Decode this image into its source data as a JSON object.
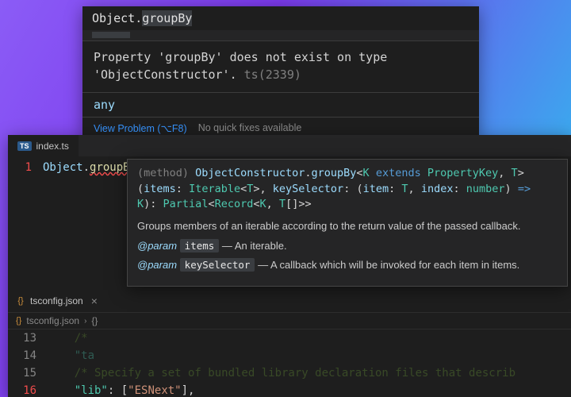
{
  "error_tooltip": {
    "code_line_prefix": "Object",
    "code_line_dot": ".",
    "code_line_method": "groupBy",
    "message_l1": "Property 'groupBy' does not exist on type",
    "message_l2": "'ObjectConstructor'.",
    "error_code": "ts(2339)",
    "type_text": "any",
    "view_problem_label": "View Problem (⌥F8)",
    "no_fix_label": "No quick fixes available"
  },
  "editor_top": {
    "tab_badge": "TS",
    "tab_label": "index.ts",
    "line1_num": "1",
    "line1_obj": "Object",
    "line1_dot": ".",
    "line1_method": "groupBy"
  },
  "signature": {
    "raw_l1": "(method) ObjectConstructor.groupBy<K extends PropertyKey, T>",
    "raw_l2": "(items: Iterable<T>, keySelector: (item: T, index: number) =>",
    "raw_l3": "K): Partial<Record<K, T[]>>",
    "desc": "Groups members of an iterable according to the return value of the passed callback.",
    "param1_tag": "@param",
    "param1_name": "items",
    "param1_desc": " — An iterable.",
    "param2_tag": "@param",
    "param2_name": "keySelector",
    "param2_desc": " — A callback which will be invoked for each item in items."
  },
  "tsconfig": {
    "tab_label": "tsconfig.json",
    "breadcrumb_file": "tsconfig.json",
    "breadcrumb_scope": "{}",
    "lines": {
      "n13": "13",
      "c13": "    /*",
      "n14": "14",
      "c14_pre": "    ",
      "c14_key": "\"ta",
      "n15": "15",
      "c15": "    /* Specify a set of bundled library declaration files that describ",
      "n16": "16",
      "c16_pre": "    ",
      "c16_key": "\"lib\"",
      "c16_colon": ": [",
      "c16_val": "\"ESNext\"",
      "c16_end": "],"
    }
  }
}
